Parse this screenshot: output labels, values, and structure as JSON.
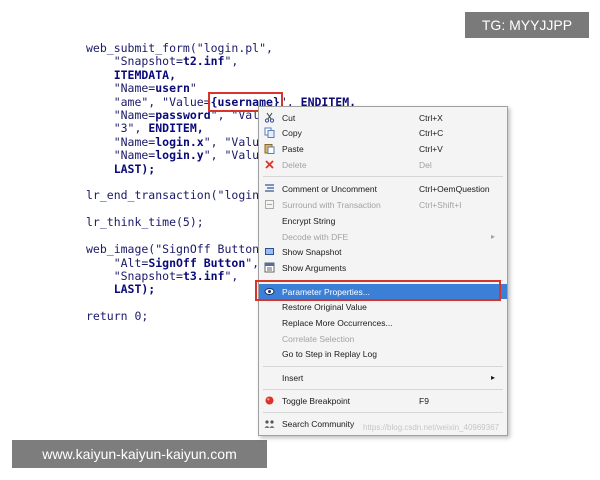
{
  "code": {
    "l1a": "web_submit_form(\"login.pl\",",
    "l2a": "    \"Snapshot=",
    "l2b": "t2.inf",
    "l2c": "\",",
    "l3a": "    ITEMDATA,",
    "l4a": "    \"Name=",
    "l4b": "usern",
    "l4c": "\"",
    "l5a": "    \"ame\", \"Value=",
    "l5b": "{username}",
    "l5c": "\", ",
    "l5d": "ENDITEM,",
    "l6a": "    \"Name=",
    "l6b": "password",
    "l6c": "\", \"Value=",
    "l7a": "    \"3\", ",
    "l7b": "ENDITEM,",
    "l8a": "    \"Name=",
    "l8b": "login.x",
    "l8c": "\", \"Value=",
    "l9a": "    \"Name=",
    "l9b": "login.y",
    "l9c": "\", \"Value=",
    "l10a": "    LAST);",
    "l12a": "lr_end_transaction(\"login_t",
    "l14a": "lr_think_time(5);",
    "l16a": "web_image(\"SignOff Button\",",
    "l17a": "    \"Alt=",
    "l17b": "SignOff Button",
    "l17c": "\",",
    "l18a": "    \"Snapshot=",
    "l18b": "t3.inf",
    "l18c": "\",",
    "l19a": "    LAST);",
    "l21a": "return 0;"
  },
  "overlays": {
    "tg": "TG: MYYJJPP",
    "url": "www.kaiyun-kaiyun-kaiyun.com",
    "watermark": "https://blog.csdn.net/weixin_40969367"
  },
  "menu": {
    "cut": {
      "label": "Cut",
      "shortcut": "Ctrl+X",
      "icon": "scissors-icon"
    },
    "copy": {
      "label": "Copy",
      "shortcut": "Ctrl+C",
      "icon": "copy-icon"
    },
    "paste": {
      "label": "Paste",
      "shortcut": "Ctrl+V",
      "icon": "paste-icon"
    },
    "delete": {
      "label": "Delete",
      "shortcut": "Del",
      "icon": "delete-icon"
    },
    "comment": {
      "label": "Comment or Uncomment",
      "shortcut": "Ctrl+OemQuestion",
      "icon": "comment-icon"
    },
    "surround": {
      "label": "Surround with Transaction",
      "shortcut": "Ctrl+Shift+I",
      "icon": "transaction-icon"
    },
    "encrypt": {
      "label": "Encrypt String"
    },
    "decode": {
      "label": "Decode with DFE"
    },
    "snapshot": {
      "label": "Show Snapshot",
      "icon": "snapshot-icon"
    },
    "arguments": {
      "label": "Show Arguments",
      "icon": "arguments-icon"
    },
    "paramprops": {
      "label": "Parameter Properties...",
      "icon": "parameter-icon"
    },
    "restore": {
      "label": "Restore Original Value"
    },
    "replace": {
      "label": "Replace More Occurrences..."
    },
    "correlate": {
      "label": "Correlate Selection"
    },
    "gotostep": {
      "label": "Go to Step in Replay Log"
    },
    "insert": {
      "label": "Insert"
    },
    "breakpoint": {
      "label": "Toggle Breakpoint",
      "shortcut": "F9",
      "icon": "breakpoint-icon"
    },
    "community": {
      "label": "Search Community",
      "icon": "community-icon"
    }
  },
  "colors": {
    "highlight": "#d9342b",
    "selection": "#3c7fd6"
  }
}
